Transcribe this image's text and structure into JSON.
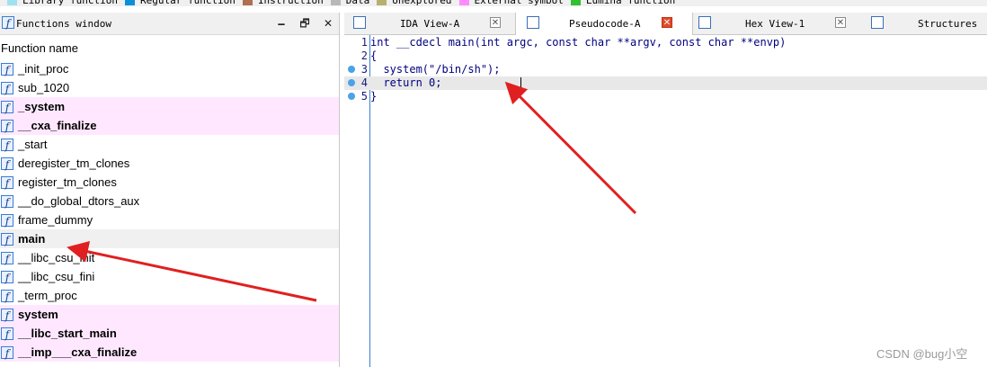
{
  "legend": [
    {
      "label": "Library function",
      "color": "#a0e0f0"
    },
    {
      "label": "Regular function",
      "color": "#0a8fd8"
    },
    {
      "label": "Instruction",
      "color": "#b07050"
    },
    {
      "label": "Data",
      "color": "#b8b8b8"
    },
    {
      "label": "Unexplored",
      "color": "#b8b070"
    },
    {
      "label": "External symbol",
      "color": "#ff8cff"
    },
    {
      "label": "Lumina function",
      "color": "#30c030"
    }
  ],
  "functions_window": {
    "title": "Functions window",
    "column_header": "Function name",
    "icon": "function-icon",
    "functions": [
      {
        "name": "_init_proc",
        "style": "normal"
      },
      {
        "name": "sub_1020",
        "style": "normal"
      },
      {
        "name": "_system",
        "style": "external"
      },
      {
        "name": "__cxa_finalize",
        "style": "external"
      },
      {
        "name": "_start",
        "style": "normal"
      },
      {
        "name": "deregister_tm_clones",
        "style": "normal"
      },
      {
        "name": "register_tm_clones",
        "style": "normal"
      },
      {
        "name": "__do_global_dtors_aux",
        "style": "normal"
      },
      {
        "name": "frame_dummy",
        "style": "normal"
      },
      {
        "name": "main",
        "style": "selected"
      },
      {
        "name": "__libc_csu_init",
        "style": "normal"
      },
      {
        "name": "__libc_csu_fini",
        "style": "normal"
      },
      {
        "name": "_term_proc",
        "style": "normal"
      },
      {
        "name": "system",
        "style": "external"
      },
      {
        "name": "__libc_start_main",
        "style": "external"
      },
      {
        "name": "__imp___cxa_finalize",
        "style": "external"
      }
    ]
  },
  "tabs": [
    {
      "label": "IDA View-A",
      "icon": "ida-view-icon",
      "active": false
    },
    {
      "label": "Pseudocode-A",
      "icon": "pseudocode-icon",
      "active": true
    },
    {
      "label": "Hex View-1",
      "icon": "hex-view-icon",
      "active": false
    },
    {
      "label": "Structures",
      "icon": "structures-icon",
      "active": false
    }
  ],
  "pseudocode": [
    {
      "num": "1",
      "text": "int __cdecl main(int argc, const char **argv, const char **envp)",
      "breakpoint": false,
      "current": false
    },
    {
      "num": "2",
      "text": "{",
      "breakpoint": false,
      "current": false
    },
    {
      "num": "3",
      "text": "  system(\"/bin/sh\");",
      "breakpoint": true,
      "current": false
    },
    {
      "num": "4",
      "text": "  return 0;",
      "breakpoint": true,
      "current": true
    },
    {
      "num": "5",
      "text": "}",
      "breakpoint": true,
      "current": false
    }
  ],
  "watermark": "CSDN @bug小空",
  "annotation_color": "#e02020"
}
